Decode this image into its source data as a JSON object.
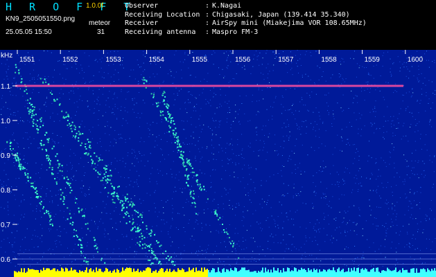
{
  "header": {
    "brand": "H R O F F T",
    "version": "1.0.0f",
    "filename": "KN9_2505051550.png",
    "datetime": "25.05.05 15:50",
    "meteor_label": "meteor",
    "meteor_count": "31",
    "info": [
      {
        "key": "Observer",
        "value": "K.Nagai"
      },
      {
        "key": "Receiving Location",
        "value": "Chigasaki, Japan (139.414 35.340)"
      },
      {
        "key": "Receiver",
        "value": "AirSpy mini (Miakejima VOR 108.65MHz)"
      },
      {
        "key": "Receiving antenna",
        "value": "Maspro FM-3"
      }
    ]
  },
  "chart_data": {
    "type": "heatmap",
    "x_ticks": [
      "1551",
      "1552",
      "1553",
      "1554",
      "1555",
      "1556",
      "1557",
      "1558",
      "1559",
      "1600"
    ],
    "y_unit": "kHz",
    "y_ticks": [
      "1.1",
      "1.0",
      "0.9",
      "0.8",
      "0.7",
      "0.6"
    ],
    "y_values": [
      1.1,
      1.0,
      0.9,
      0.8,
      0.7,
      0.6
    ],
    "ylim": [
      0.58,
      1.19
    ],
    "carrier_khz": 1.1,
    "colors": {
      "background": "#001a99",
      "noise": "#1f6cff",
      "signal": "#3dffd0",
      "carrier": "#ff4fa0",
      "floor": "#ffff00"
    }
  }
}
